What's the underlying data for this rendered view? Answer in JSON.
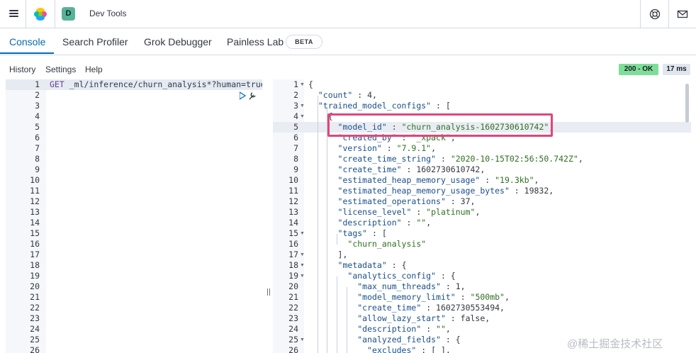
{
  "header": {
    "space_initial": "D",
    "app_title": "Dev Tools",
    "icons": [
      "menu-icon",
      "elastic-logo-icon",
      "help-icon",
      "mail-icon"
    ]
  },
  "tabs": [
    {
      "label": "Console",
      "active": true
    },
    {
      "label": "Search Profiler",
      "active": false
    },
    {
      "label": "Grok Debugger",
      "active": false
    },
    {
      "label": "Painless Lab",
      "active": false
    }
  ],
  "beta_badge": "BETA",
  "console_menu": [
    "History",
    "Settings",
    "Help"
  ],
  "status": {
    "code": "200 - OK",
    "time": "17 ms",
    "ok_color": "#7dde99"
  },
  "request": {
    "method": "GET",
    "path": "_ml/inference/churn_analysis*?human=true",
    "line_numbers": [
      "1",
      "2",
      "3",
      "4",
      "5",
      "6",
      "7",
      "8",
      "9",
      "10",
      "11",
      "12",
      "13",
      "14",
      "15",
      "16",
      "17",
      "18",
      "19",
      "20",
      "21",
      "22",
      "23",
      "24",
      "25",
      "26"
    ]
  },
  "response": {
    "lines": [
      {
        "n": "1",
        "fold": true,
        "text": "{"
      },
      {
        "n": "2",
        "fold": false,
        "text": "  \"count\" : 4,"
      },
      {
        "n": "3",
        "fold": true,
        "text": "  \"trained_model_configs\" : ["
      },
      {
        "n": "4",
        "fold": true,
        "text": "    {"
      },
      {
        "n": "5",
        "fold": false,
        "text": "      \"model_id\" : \"churn_analysis-1602730610742\","
      },
      {
        "n": "6",
        "fold": false,
        "text": "      \"created_by\" : \"_xpack\","
      },
      {
        "n": "7",
        "fold": false,
        "text": "      \"version\" : \"7.9.1\","
      },
      {
        "n": "8",
        "fold": false,
        "text": "      \"create_time_string\" : \"2020-10-15T02:56:50.742Z\","
      },
      {
        "n": "9",
        "fold": false,
        "text": "      \"create_time\" : 1602730610742,"
      },
      {
        "n": "10",
        "fold": false,
        "text": "      \"estimated_heap_memory_usage\" : \"19.3kb\","
      },
      {
        "n": "11",
        "fold": false,
        "text": "      \"estimated_heap_memory_usage_bytes\" : 19832,"
      },
      {
        "n": "12",
        "fold": false,
        "text": "      \"estimated_operations\" : 37,"
      },
      {
        "n": "13",
        "fold": false,
        "text": "      \"license_level\" : \"platinum\","
      },
      {
        "n": "14",
        "fold": false,
        "text": "      \"description\" : \"\","
      },
      {
        "n": "15",
        "fold": true,
        "text": "      \"tags\" : ["
      },
      {
        "n": "16",
        "fold": false,
        "text": "        \"churn_analysis\""
      },
      {
        "n": "17",
        "fold": true,
        "text": "      ],"
      },
      {
        "n": "18",
        "fold": true,
        "text": "      \"metadata\" : {"
      },
      {
        "n": "19",
        "fold": true,
        "text": "        \"analytics_config\" : {"
      },
      {
        "n": "20",
        "fold": false,
        "text": "          \"max_num_threads\" : 1,"
      },
      {
        "n": "21",
        "fold": false,
        "text": "          \"model_memory_limit\" : \"500mb\","
      },
      {
        "n": "22",
        "fold": false,
        "text": "          \"create_time\" : 1602730553494,"
      },
      {
        "n": "23",
        "fold": false,
        "text": "          \"allow_lazy_start\" : false,"
      },
      {
        "n": "24",
        "fold": false,
        "text": "          \"description\" : \"\","
      },
      {
        "n": "25",
        "fold": true,
        "text": "          \"analyzed_fields\" : {"
      },
      {
        "n": "26",
        "fold": false,
        "text": "            \"excludes\" : [ ],"
      }
    ]
  },
  "watermark": "@稀土掘金技术社区"
}
